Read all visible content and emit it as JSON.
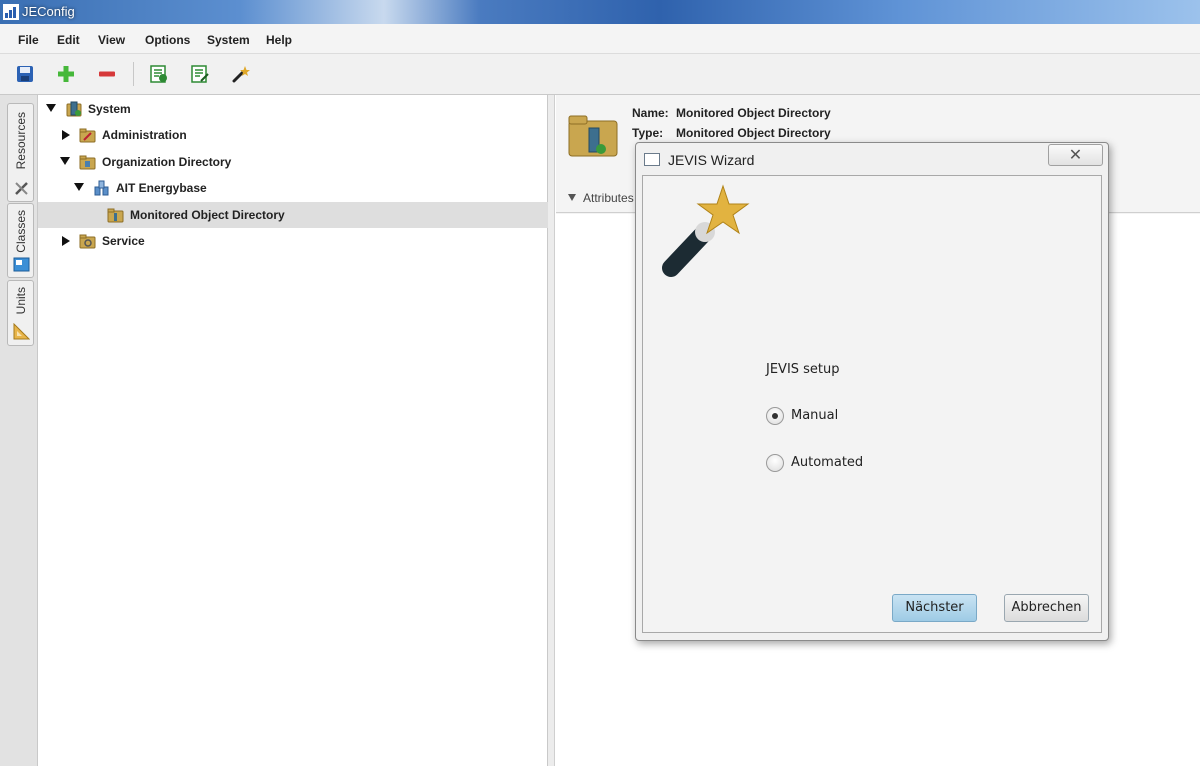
{
  "window": {
    "title": "JEConfig"
  },
  "menu": {
    "items": [
      {
        "label": "File"
      },
      {
        "label": "Edit"
      },
      {
        "label": "View"
      },
      {
        "label": "Options"
      },
      {
        "label": "System"
      },
      {
        "label": "Help"
      }
    ]
  },
  "toolbar": {
    "buttons": [
      "save-icon",
      "add-icon",
      "remove-icon",
      "new-list-icon",
      "edit-list-icon",
      "wizard-icon"
    ]
  },
  "side_tabs": [
    {
      "label": "Resources",
      "icon": "tools-icon"
    },
    {
      "label": "Classes",
      "icon": "class-icon"
    },
    {
      "label": "Units",
      "icon": "ruler-icon"
    }
  ],
  "tree": {
    "nodes": [
      {
        "label": "System",
        "expanded": true
      },
      {
        "label": "Administration",
        "expanded": false
      },
      {
        "label": "Organization Directory",
        "expanded": true
      },
      {
        "label": "AIT Energybase",
        "expanded": true
      },
      {
        "label": "Monitored Object Directory",
        "selected": true
      },
      {
        "label": "Service",
        "expanded": false
      }
    ]
  },
  "detail": {
    "name_label": "Name:",
    "name_value": "Monitored Object Directory",
    "type_label": "Type:",
    "type_value": "Monitored Object Directory",
    "attributes_label": "Attributes"
  },
  "dialog": {
    "title": "JEVIS Wizard",
    "close": "✕",
    "setup_label": "JEVIS setup",
    "options": [
      {
        "label": "Manual",
        "checked": true
      },
      {
        "label": "Automated",
        "checked": false
      }
    ],
    "next_button": "Nächster",
    "cancel_button": "Abbrechen"
  },
  "colors": {
    "primary_button": "#9ecbe5",
    "folder": "#c9a64f",
    "selection": "#dedede"
  }
}
